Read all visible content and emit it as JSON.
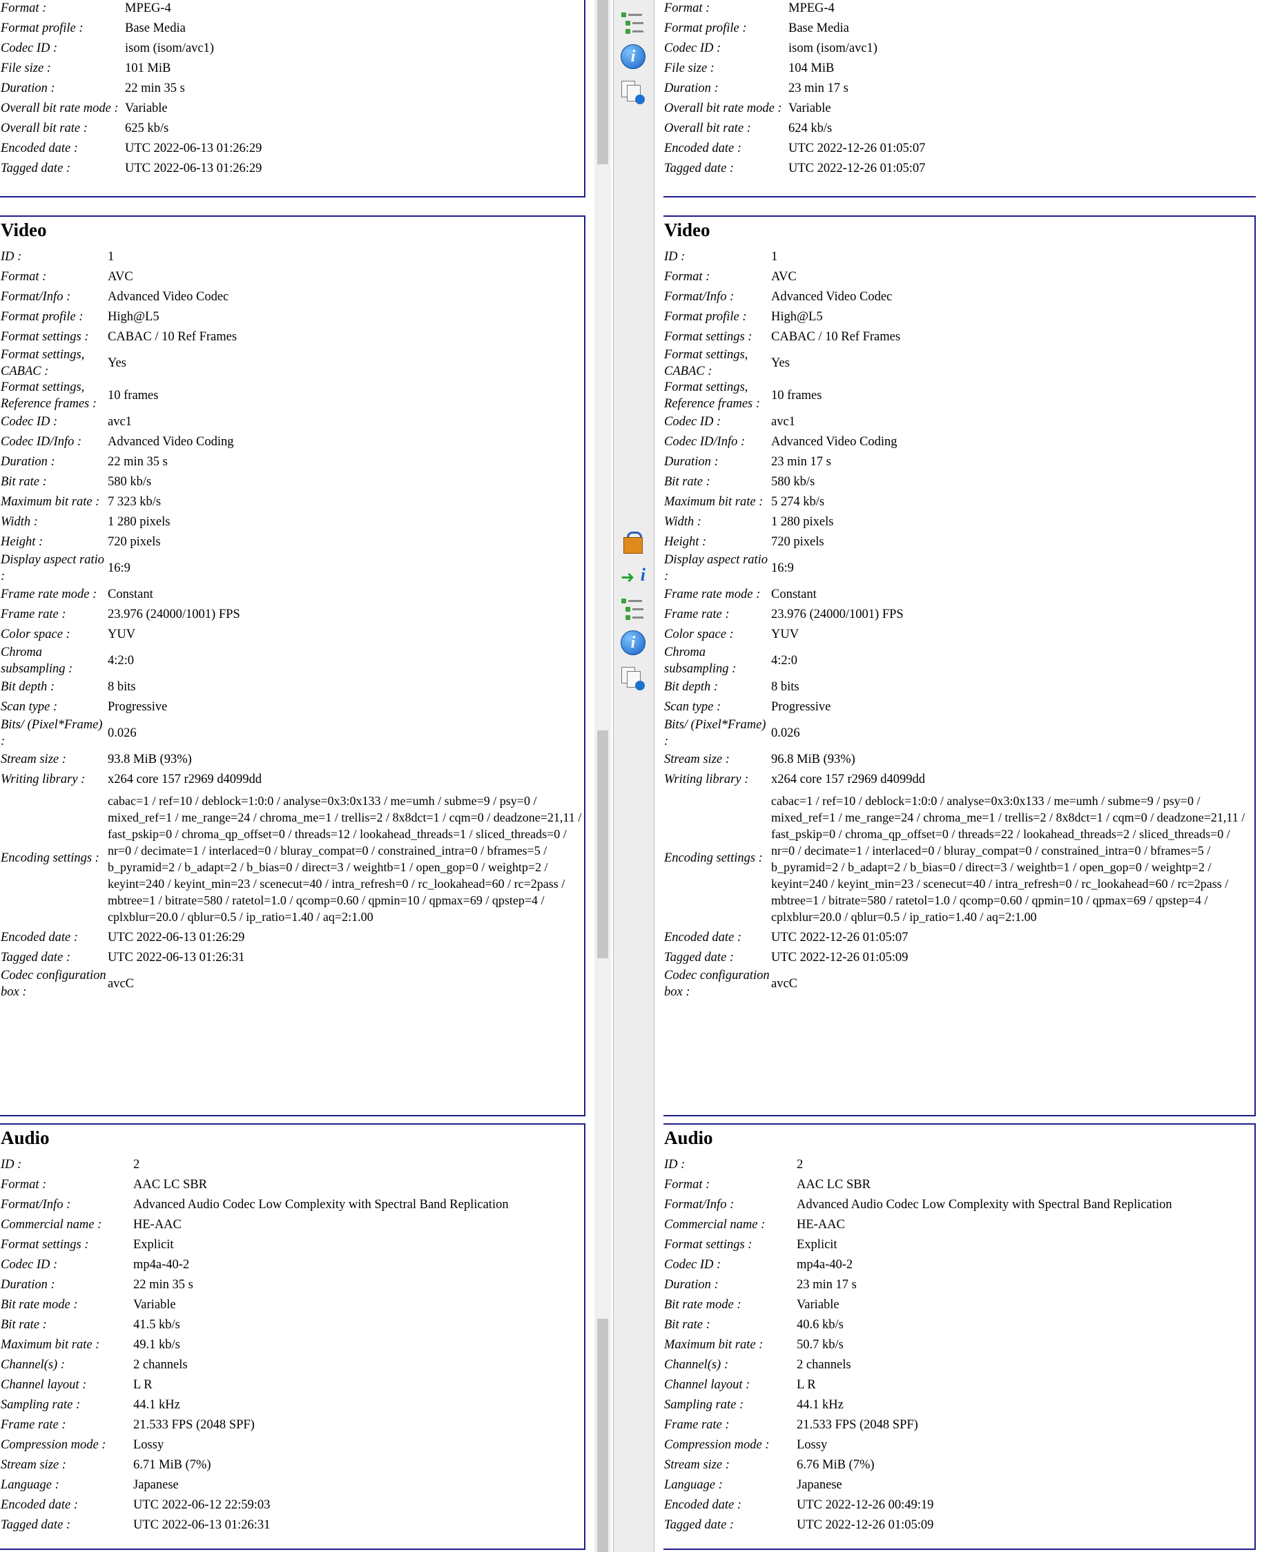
{
  "left": {
    "general": {
      "rows": [
        {
          "label": "Format :",
          "value": "MPEG-4"
        },
        {
          "label": "Format profile :",
          "value": "Base Media"
        },
        {
          "label": "Codec ID :",
          "value": "isom (isom/avc1)"
        },
        {
          "label": "File size :",
          "value": "101 MiB"
        },
        {
          "label": "Duration :",
          "value": "22 min 35 s"
        },
        {
          "label": "Overall bit rate mode :",
          "value": "Variable"
        },
        {
          "label": "Overall bit rate :",
          "value": "625 kb/s"
        },
        {
          "label": "Encoded date :",
          "value": "UTC 2022-06-13 01:26:29"
        },
        {
          "label": "Tagged date :",
          "value": "UTC 2022-06-13 01:26:29"
        }
      ]
    },
    "video": {
      "title": "Video",
      "rows": [
        {
          "label": "ID :",
          "value": "1"
        },
        {
          "label": "Format :",
          "value": "AVC"
        },
        {
          "label": "Format/Info :",
          "value": "Advanced Video Codec"
        },
        {
          "label": "Format profile :",
          "value": "High@L5"
        },
        {
          "label": "Format settings :",
          "value": "CABAC / 10 Ref Frames"
        },
        {
          "label": "Format settings, CABAC :",
          "value": "Yes"
        },
        {
          "label": "Format settings, Reference frames :",
          "value": "10 frames"
        },
        {
          "label": "Codec ID :",
          "value": "avc1"
        },
        {
          "label": "Codec ID/Info :",
          "value": "Advanced Video Coding"
        },
        {
          "label": "Duration :",
          "value": "22 min 35 s"
        },
        {
          "label": "Bit rate :",
          "value": "580 kb/s"
        },
        {
          "label": "Maximum bit rate :",
          "value": "7 323 kb/s"
        },
        {
          "label": "Width :",
          "value": "1 280 pixels"
        },
        {
          "label": "Height :",
          "value": "720 pixels"
        },
        {
          "label": "Display aspect ratio :",
          "value": "16:9"
        },
        {
          "label": "Frame rate mode :",
          "value": "Constant"
        },
        {
          "label": "Frame rate :",
          "value": "23.976 (24000/1001) FPS"
        },
        {
          "label": "Color space :",
          "value": "YUV"
        },
        {
          "label": "Chroma subsampling :",
          "value": "4:2:0"
        },
        {
          "label": "Bit depth :",
          "value": "8 bits"
        },
        {
          "label": "Scan type :",
          "value": "Progressive"
        },
        {
          "label": "Bits/ (Pixel*Frame) :",
          "value": "0.026"
        },
        {
          "label": "Stream size :",
          "value": "93.8 MiB (93%)"
        },
        {
          "label": "Writing library :",
          "value": "x264 core 157 r2969 d4099dd"
        },
        {
          "label": "Encoding settings :",
          "value": "cabac=1 / ref=10 / deblock=1:0:0 / analyse=0x3:0x133 / me=umh / subme=9 / psy=0 / mixed_ref=1 / me_range=24 / chroma_me=1 / trellis=2 / 8x8dct=1 / cqm=0 / deadzone=21,11 / fast_pskip=0 / chroma_qp_offset=0 / threads=12 / lookahead_threads=1 / sliced_threads=0 / nr=0 / decimate=1 / interlaced=0 / bluray_compat=0 / constrained_intra=0 / bframes=5 / b_pyramid=2 / b_adapt=2 / b_bias=0 / direct=3 / weightb=1 / open_gop=0 / weightp=2 / keyint=240 / keyint_min=23 / scenecut=40 / intra_refresh=0 / rc_lookahead=60 / rc=2pass / mbtree=1 / bitrate=580 / ratetol=1.0 / qcomp=0.60 / qpmin=10 / qpmax=69 / qpstep=4 / cplxblur=20.0 / qblur=0.5 / ip_ratio=1.40 / aq=2:1.00"
        },
        {
          "label": "Encoded date :",
          "value": "UTC 2022-06-13 01:26:29"
        },
        {
          "label": "Tagged date :",
          "value": "UTC 2022-06-13 01:26:31"
        },
        {
          "label": "Codec configuration box :",
          "value": "avcC"
        }
      ]
    },
    "audio": {
      "title": "Audio",
      "rows": [
        {
          "label": "ID :",
          "value": "2"
        },
        {
          "label": "Format :",
          "value": "AAC LC SBR"
        },
        {
          "label": "Format/Info :",
          "value": "Advanced Audio Codec Low Complexity with Spectral Band Replication"
        },
        {
          "label": "Commercial name :",
          "value": "HE-AAC"
        },
        {
          "label": "Format settings :",
          "value": "Explicit"
        },
        {
          "label": "Codec ID :",
          "value": "mp4a-40-2"
        },
        {
          "label": "Duration :",
          "value": "22 min 35 s"
        },
        {
          "label": "Bit rate mode :",
          "value": "Variable"
        },
        {
          "label": "Bit rate :",
          "value": "41.5 kb/s"
        },
        {
          "label": "Maximum bit rate :",
          "value": "49.1 kb/s"
        },
        {
          "label": "Channel(s) :",
          "value": "2 channels"
        },
        {
          "label": "Channel layout :",
          "value": "L R"
        },
        {
          "label": "Sampling rate :",
          "value": "44.1 kHz"
        },
        {
          "label": "Frame rate :",
          "value": "21.533 FPS (2048 SPF)"
        },
        {
          "label": "Compression mode :",
          "value": "Lossy"
        },
        {
          "label": "Stream size :",
          "value": "6.71 MiB (7%)"
        },
        {
          "label": "Language :",
          "value": "Japanese"
        },
        {
          "label": "Encoded date :",
          "value": "UTC 2022-06-12 22:59:03"
        },
        {
          "label": "Tagged date :",
          "value": "UTC 2022-06-13 01:26:31"
        }
      ]
    }
  },
  "right": {
    "general": {
      "rows": [
        {
          "label": "Format :",
          "value": "MPEG-4"
        },
        {
          "label": "Format profile :",
          "value": "Base Media"
        },
        {
          "label": "Codec ID :",
          "value": "isom (isom/avc1)"
        },
        {
          "label": "File size :",
          "value": "104 MiB"
        },
        {
          "label": "Duration :",
          "value": "23 min 17 s"
        },
        {
          "label": "Overall bit rate mode :",
          "value": "Variable"
        },
        {
          "label": "Overall bit rate :",
          "value": "624 kb/s"
        },
        {
          "label": "Encoded date :",
          "value": "UTC 2022-12-26 01:05:07"
        },
        {
          "label": "Tagged date :",
          "value": "UTC 2022-12-26 01:05:07"
        }
      ]
    },
    "video": {
      "title": "Video",
      "rows": [
        {
          "label": "ID :",
          "value": "1"
        },
        {
          "label": "Format :",
          "value": "AVC"
        },
        {
          "label": "Format/Info :",
          "value": "Advanced Video Codec"
        },
        {
          "label": "Format profile :",
          "value": "High@L5"
        },
        {
          "label": "Format settings :",
          "value": "CABAC / 10 Ref Frames"
        },
        {
          "label": "Format settings, CABAC :",
          "value": "Yes"
        },
        {
          "label": "Format settings, Reference frames :",
          "value": "10 frames"
        },
        {
          "label": "Codec ID :",
          "value": "avc1"
        },
        {
          "label": "Codec ID/Info :",
          "value": "Advanced Video Coding"
        },
        {
          "label": "Duration :",
          "value": "23 min 17 s"
        },
        {
          "label": "Bit rate :",
          "value": "580 kb/s"
        },
        {
          "label": "Maximum bit rate :",
          "value": "5 274 kb/s"
        },
        {
          "label": "Width :",
          "value": "1 280 pixels"
        },
        {
          "label": "Height :",
          "value": "720 pixels"
        },
        {
          "label": "Display aspect ratio :",
          "value": "16:9"
        },
        {
          "label": "Frame rate mode :",
          "value": "Constant"
        },
        {
          "label": "Frame rate :",
          "value": "23.976 (24000/1001) FPS"
        },
        {
          "label": "Color space :",
          "value": "YUV"
        },
        {
          "label": "Chroma subsampling :",
          "value": "4:2:0"
        },
        {
          "label": "Bit depth :",
          "value": "8 bits"
        },
        {
          "label": "Scan type :",
          "value": "Progressive"
        },
        {
          "label": "Bits/ (Pixel*Frame) :",
          "value": "0.026"
        },
        {
          "label": "Stream size :",
          "value": "96.8 MiB (93%)"
        },
        {
          "label": "Writing library :",
          "value": "x264 core 157 r2969 d4099dd"
        },
        {
          "label": "Encoding settings :",
          "value": "cabac=1 / ref=10 / deblock=1:0:0 / analyse=0x3:0x133 / me=umh / subme=9 / psy=0 / mixed_ref=1 / me_range=24 / chroma_me=1 / trellis=2 / 8x8dct=1 / cqm=0 / deadzone=21,11 / fast_pskip=0 / chroma_qp_offset=0 / threads=22 / lookahead_threads=2 / sliced_threads=0 / nr=0 / decimate=1 / interlaced=0 / bluray_compat=0 / constrained_intra=0 / bframes=5 / b_pyramid=2 / b_adapt=2 / b_bias=0 / direct=3 / weightb=1 / open_gop=0 / weightp=2 / keyint=240 / keyint_min=23 / scenecut=40 / intra_refresh=0 / rc_lookahead=60 / rc=2pass / mbtree=1 / bitrate=580 / ratetol=1.0 / qcomp=0.60 / qpmin=10 / qpmax=69 / qpstep=4 / cplxblur=20.0 / qblur=0.5 / ip_ratio=1.40 / aq=2:1.00"
        },
        {
          "label": "Encoded date :",
          "value": "UTC 2022-12-26 01:05:07"
        },
        {
          "label": "Tagged date :",
          "value": "UTC 2022-12-26 01:05:09"
        },
        {
          "label": "Codec configuration box :",
          "value": "avcC"
        }
      ]
    },
    "audio": {
      "title": "Audio",
      "rows": [
        {
          "label": "ID :",
          "value": "2"
        },
        {
          "label": "Format :",
          "value": "AAC LC SBR"
        },
        {
          "label": "Format/Info :",
          "value": "Advanced Audio Codec Low Complexity with Spectral Band Replication"
        },
        {
          "label": "Commercial name :",
          "value": "HE-AAC"
        },
        {
          "label": "Format settings :",
          "value": "Explicit"
        },
        {
          "label": "Codec ID :",
          "value": "mp4a-40-2"
        },
        {
          "label": "Duration :",
          "value": "23 min 17 s"
        },
        {
          "label": "Bit rate mode :",
          "value": "Variable"
        },
        {
          "label": "Bit rate :",
          "value": "40.6 kb/s"
        },
        {
          "label": "Maximum bit rate :",
          "value": "50.7 kb/s"
        },
        {
          "label": "Channel(s) :",
          "value": "2 channels"
        },
        {
          "label": "Channel layout :",
          "value": "L R"
        },
        {
          "label": "Sampling rate :",
          "value": "44.1 kHz"
        },
        {
          "label": "Frame rate :",
          "value": "21.533 FPS (2048 SPF)"
        },
        {
          "label": "Compression mode :",
          "value": "Lossy"
        },
        {
          "label": "Stream size :",
          "value": "6.76 MiB (7%)"
        },
        {
          "label": "Language :",
          "value": "Japanese"
        },
        {
          "label": "Encoded date :",
          "value": "UTC 2022-12-26 00:49:19"
        },
        {
          "label": "Tagged date :",
          "value": "UTC 2022-12-26 01:05:09"
        }
      ]
    }
  },
  "toolbar": {
    "icons": [
      "tree-view-icon",
      "info-icon",
      "sheet-view-icon",
      "package-icon",
      "export-info-icon",
      "tree-view-icon",
      "info-icon",
      "sheet-view-icon"
    ]
  },
  "colors": {
    "border": "#1e1e8c",
    "toolbar_bg": "#ededed"
  }
}
